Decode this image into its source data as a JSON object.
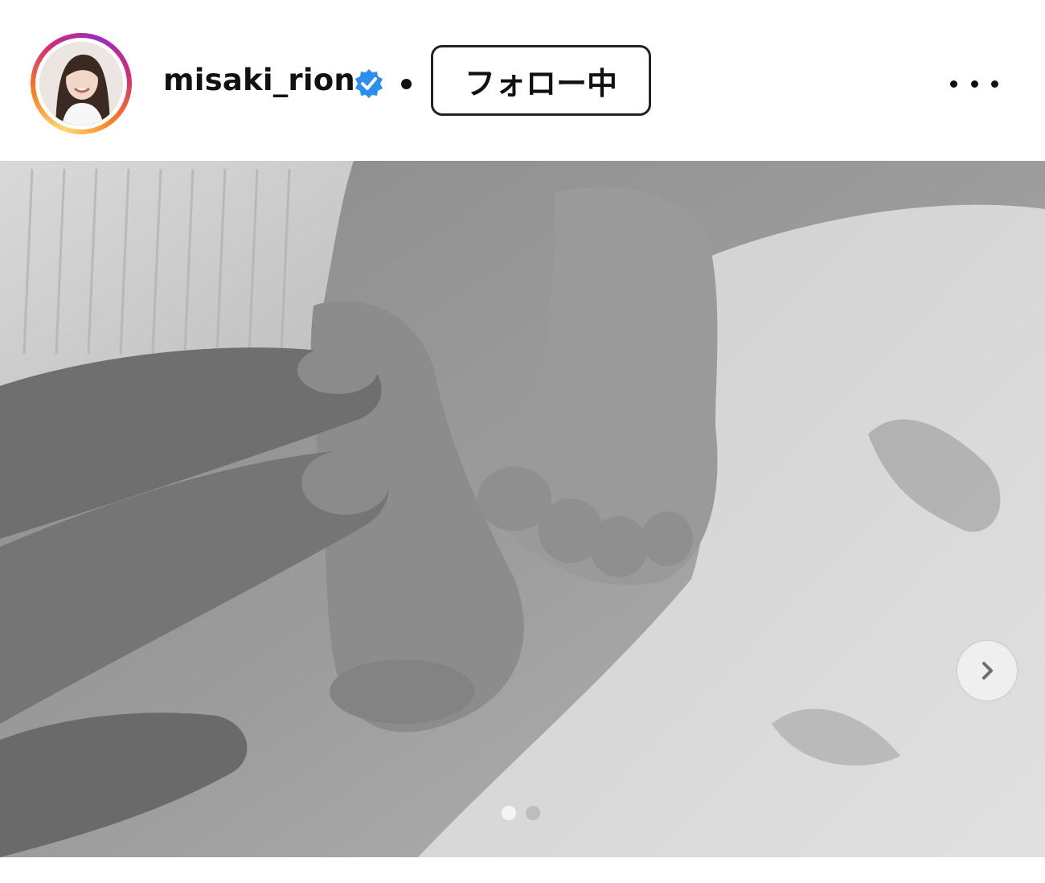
{
  "header": {
    "username": "misaki_rion",
    "follow_label": "フォロー中",
    "separator": "•"
  },
  "carousel": {
    "total": 2,
    "active": 1
  },
  "colors": {
    "verified": "#2c8fef",
    "dot_active": "#f5f5f5",
    "dot_inactive": "#bdbdbd"
  },
  "icons": {
    "verified": "verified-badge-icon",
    "more": "more-options-icon",
    "next": "chevron-right-icon"
  }
}
